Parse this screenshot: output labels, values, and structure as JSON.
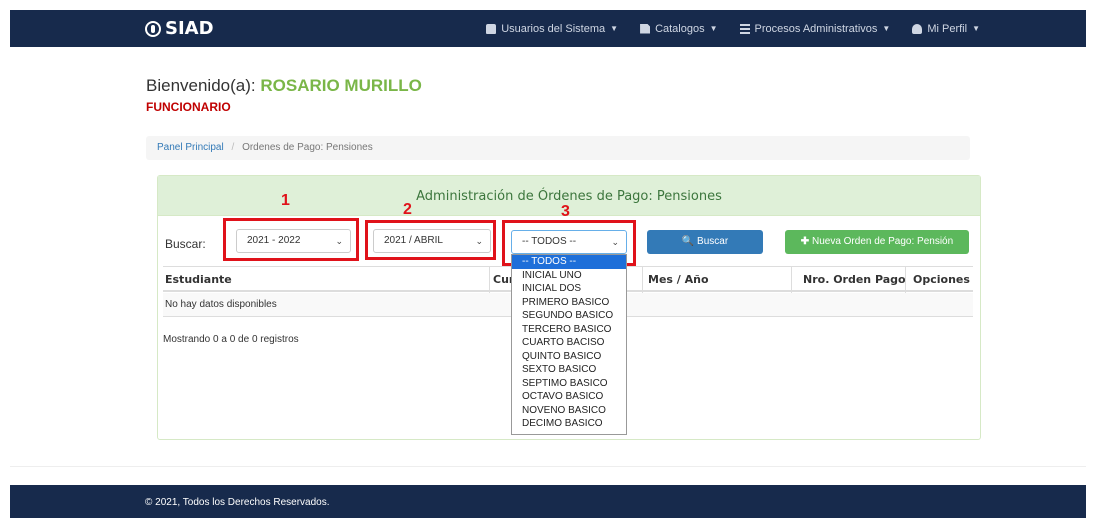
{
  "navbar": {
    "brand": "SIAD",
    "menu": [
      {
        "label": "Usuarios del Sistema",
        "icon": "lock-icon"
      },
      {
        "label": "Catalogos",
        "icon": "file-icon"
      },
      {
        "label": "Procesos Administrativos",
        "icon": "list-icon"
      },
      {
        "label": "Mi Perfil",
        "icon": "user-icon"
      }
    ]
  },
  "welcome": {
    "greeting": "Bienvenido(a):",
    "name": "ROSARIO MURILLO",
    "role": "FUNCIONARIO"
  },
  "breadcrumb": {
    "home": "Panel Principal",
    "separator": "/",
    "current": "Ordenes de Pago: Pensiones"
  },
  "panel": {
    "title": "Administración de Órdenes de Pago: Pensiones",
    "search_label": "Buscar:",
    "year_select": "2021 - 2022",
    "month_select": "2021 / ABRIL",
    "grade_select": "-- TODOS --",
    "search_button": "Buscar",
    "new_button": "Nueva Orden de Pago: Pensión",
    "columns": [
      "Estudiante",
      "Cur",
      "Mes / Año",
      "Nro. Orden Pago",
      "Opciones"
    ],
    "empty_message": "No hay datos disponibles",
    "showing": "Mostrando 0 a 0 de 0 registros"
  },
  "annotations": [
    "1",
    "2",
    "3"
  ],
  "dropdown_options": [
    "-- TODOS --",
    "INICIAL UNO",
    "INICIAL DOS",
    "PRIMERO BASICO",
    "SEGUNDO BASICO",
    "TERCERO BASICO",
    "CUARTO BACISO",
    "QUINTO BASICO",
    "SEXTO BASICO",
    "SEPTIMO BASICO",
    "OCTAVO BASICO",
    "NOVENO BASICO",
    "DECIMO BASICO"
  ],
  "footer": "© 2021, Todos los Derechos Reservados.",
  "colors": {
    "navbar": "#172a4c",
    "accent_green": "#7ab648",
    "role_red": "#c00000",
    "annotation_red": "#e0121a",
    "primary": "#337ab7",
    "success": "#5cb85c"
  }
}
